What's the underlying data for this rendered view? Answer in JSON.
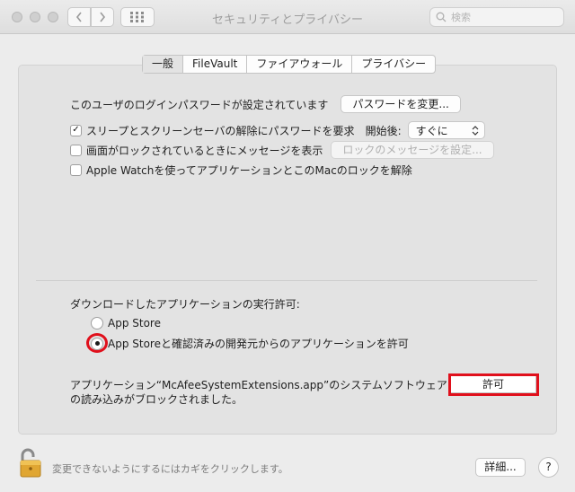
{
  "window": {
    "title": "セキュリティとプライバシー"
  },
  "toolbar": {
    "back_icon": "chevron-left-icon",
    "forward_icon": "chevron-right-icon",
    "grid_icon": "grid-icon",
    "search_placeholder": "検索"
  },
  "tabs": [
    {
      "label": "一般",
      "active": true
    },
    {
      "label": "FileVault",
      "active": false
    },
    {
      "label": "ファイアウォール",
      "active": false
    },
    {
      "label": "プライバシー",
      "active": false
    }
  ],
  "general": {
    "login_password_text": "このユーザのログインパスワードが設定されています",
    "change_password_button": "パスワードを変更...",
    "require_password_label": "スリープとスクリーンセーバの解除にパスワードを要求",
    "require_password_checked": true,
    "start_after_label": "開始後:",
    "start_after_value": "すぐに",
    "show_message_label": "画面がロックされているときにメッセージを表示",
    "show_message_checked": false,
    "set_lock_message_button": "ロックのメッセージを設定...",
    "apple_watch_label": "Apple Watchを使ってアプリケーションとこのMacのロックを解除",
    "apple_watch_checked": false
  },
  "download": {
    "heading": "ダウンロードしたアプリケーションの実行許可:",
    "options": [
      {
        "label": "App Store",
        "selected": false
      },
      {
        "label": "App Storeと確認済みの開発元からのアプリケーションを許可",
        "selected": true
      }
    ],
    "blocked_message": "アプリケーション“McAfeeSystemExtensions.app”のシステムソフトウェアの読み込みがブロックされました。",
    "allow_button": "許可"
  },
  "footer": {
    "lock_text": "変更できないようにするにはカギをクリックします。",
    "details_button": "詳細...",
    "help_button": "?"
  },
  "colors": {
    "highlight": "#e0101c",
    "window_bg": "#ececec",
    "panel_bg": "#e3e3e3"
  }
}
